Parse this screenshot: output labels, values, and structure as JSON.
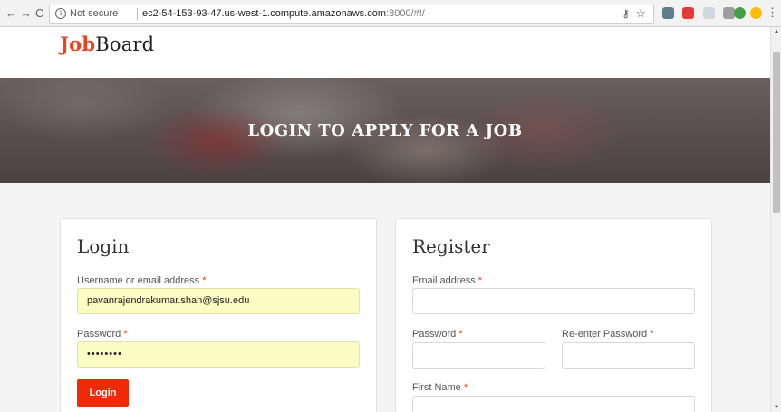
{
  "browser": {
    "back_icon": "←",
    "forward_icon": "→",
    "reload_icon": "C",
    "security_label": "Not secure",
    "url_host": "ec2-54-153-93-47.us-west-1.compute.amazonaws.com",
    "url_rest": ":8000/#!/",
    "key_icon": "key-icon",
    "star_icon": "star-icon",
    "extension_colors": [
      "#607d8b",
      "#e53935",
      "#b0bec5",
      "#9e9e9e",
      "#43a047",
      "#fbbc05"
    ]
  },
  "site": {
    "logo_accent": "Job",
    "logo_rest": "Board",
    "accent_color": "#f0411e"
  },
  "hero": {
    "title": "LOGIN TO APPLY FOR A JOB"
  },
  "login": {
    "heading": "Login",
    "username_label": "Username or email address",
    "username_value": "pavanrajendrakumar.shah@sjsu.edu",
    "password_label": "Password",
    "password_value": "••••••••",
    "required_marker": "*",
    "submit_label": "Login"
  },
  "register": {
    "heading": "Register",
    "email_label": "Email address",
    "password_label": "Password",
    "reenter_label": "Re-enter Password",
    "first_name_label": "First Name",
    "required_marker": "*"
  }
}
